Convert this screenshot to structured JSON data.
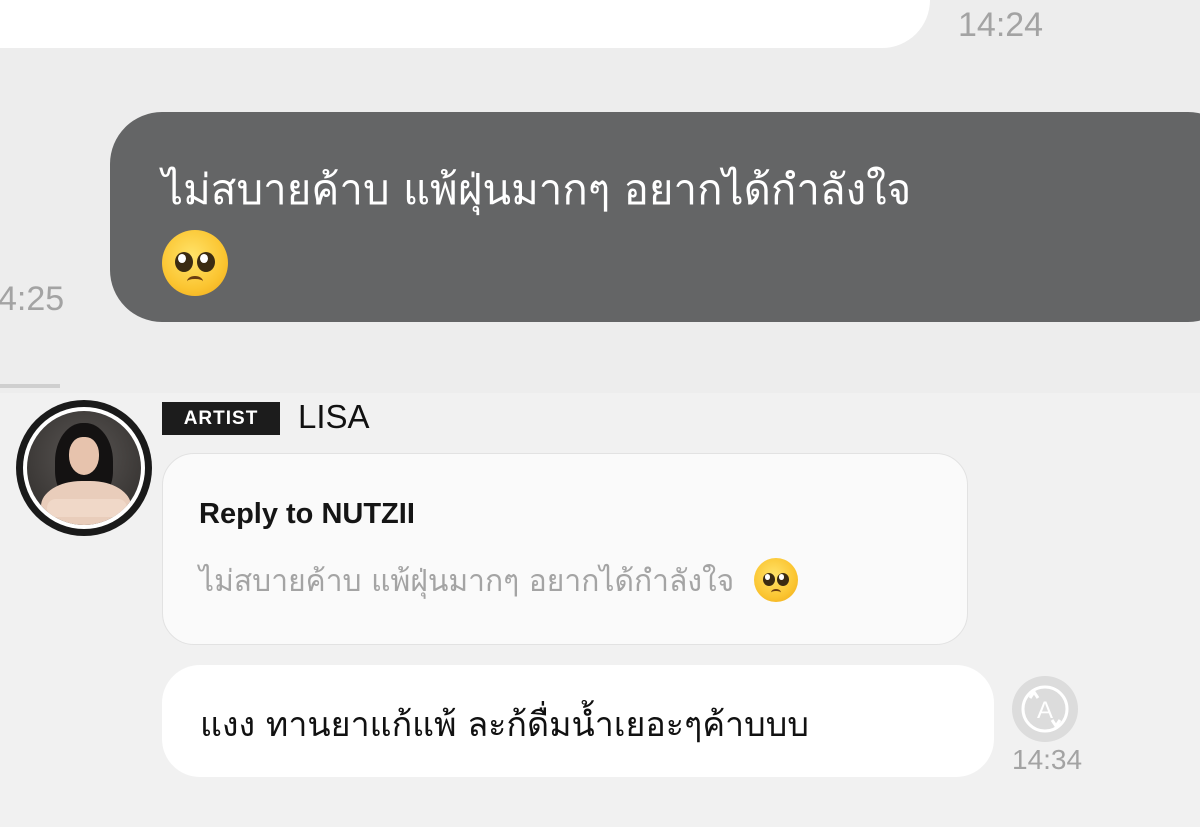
{
  "previous_message": {
    "time": "14:24"
  },
  "sent_message": {
    "text": "ไม่สบายค้าบ แพ้ฝุ่นมากๆ อยากได้กำลังใจ",
    "emoji": "pleading-face-emoji",
    "time": "4:25"
  },
  "artist_reply": {
    "badge": "ARTIST",
    "name": "LISA",
    "reply_to": "Reply to NUTZII",
    "quoted_text": "ไม่สบายค้าบ แพ้ฝุ่นมากๆ อยากได้กำลังใจ",
    "text": "แงง ทานยาแก้แพ้ ละก้ดื่มน้ำเยอะๆค้าบบบ",
    "time": "14:34",
    "translate_icon": "translate-icon"
  },
  "colors": {
    "sent_bubble": "#646566",
    "background": "#f0f0f0",
    "badge": "#1c1c1c"
  }
}
